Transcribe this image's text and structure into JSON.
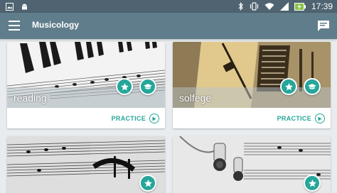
{
  "status_bar": {
    "time": "17:39",
    "left_icons": [
      "image-icon",
      "android-icon"
    ],
    "right_icons": [
      "bluetooth-icon",
      "vibrate-icon",
      "wifi-icon",
      "signal-icon",
      "battery-charging-icon"
    ]
  },
  "toolbar": {
    "title": "Musicology",
    "menu_icon": "hamburger-menu-icon",
    "action_icon": "chat-icon",
    "color": "#607d8b"
  },
  "cards": [
    {
      "label": "reading",
      "action": "PRACTICE",
      "image": "piano-keys-sheet-music",
      "badges": [
        "star-icon",
        "graduation-cap-icon"
      ]
    },
    {
      "label": "solfege",
      "action": "PRACTICE",
      "image": "metronome",
      "badges": [
        "star-icon",
        "graduation-cap-icon"
      ]
    },
    {
      "label": "",
      "action": "",
      "image": "sheet-music-pages",
      "badges": [
        "star-icon"
      ]
    },
    {
      "label": "",
      "action": "",
      "image": "earphones-on-sheet-music",
      "badges": [
        "star-icon"
      ]
    }
  ],
  "colors": {
    "accent": "#26a69a",
    "status_bar": "#4f6470",
    "background": "#e9ecee"
  }
}
